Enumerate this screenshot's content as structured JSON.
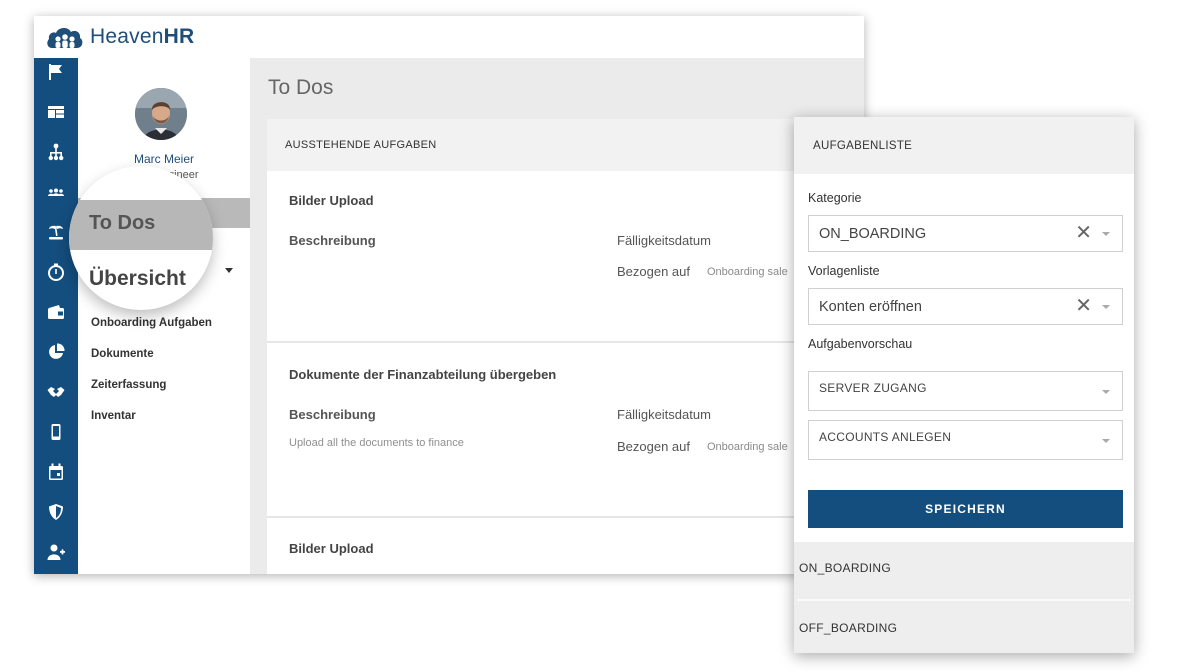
{
  "brand": {
    "name_light": "Heaven",
    "name_bold": "HR"
  },
  "sidebar_icons": [
    "flag-icon",
    "dashboard-icon",
    "org-chart-icon",
    "team-icon",
    "vacation-icon",
    "stopwatch-icon",
    "wallet-icon",
    "pie-chart-icon",
    "handshake-icon",
    "mobile-icon",
    "calendar-icon",
    "shield-icon",
    "add-user-icon"
  ],
  "profile": {
    "name": "Marc Meier",
    "role": "gineer"
  },
  "nav": {
    "todos": "To Dos",
    "uebersicht": "Übersicht",
    "items": [
      "Onboarding Aufgaben",
      "Dokumente",
      "Zeiterfassung",
      "Inventar"
    ]
  },
  "page": {
    "title": "To Dos"
  },
  "tasks_card": {
    "header": "AUSSTEHENDE AUFGABEN",
    "tasks": [
      {
        "title": "Bilder Upload",
        "desc_label": "Beschreibung",
        "description": "",
        "due_label": "Fälligkeitsdatum",
        "ref_label": "Bezogen auf",
        "ref_value": "Onboarding sale"
      },
      {
        "title": "Dokumente der Finanzabteilung übergeben",
        "desc_label": "Beschreibung",
        "description": "Upload all the documents to finance",
        "due_label": "Fälligkeitsdatum",
        "ref_label": "Bezogen auf",
        "ref_value": "Onboarding sale"
      },
      {
        "title": "Bilder Upload"
      }
    ]
  },
  "popup": {
    "header": "AUFGABENLISTE",
    "kategorie_label": "Kategorie",
    "kategorie_value": "ON_BOARDING",
    "vorlagen_label": "Vorlagenliste",
    "vorlagen_value": "Konten eröffnen",
    "vorschau_label": "Aufgabenvorschau",
    "preview_items": [
      "SERVER ZUGANG",
      "ACCOUNTS ANLEGEN"
    ],
    "save_label": "SPEICHERN",
    "categories": [
      "ON_BOARDING",
      "OFF_BOARDING"
    ]
  },
  "colors": {
    "primary": "#144e7e",
    "brand_text": "#1f4e79"
  }
}
